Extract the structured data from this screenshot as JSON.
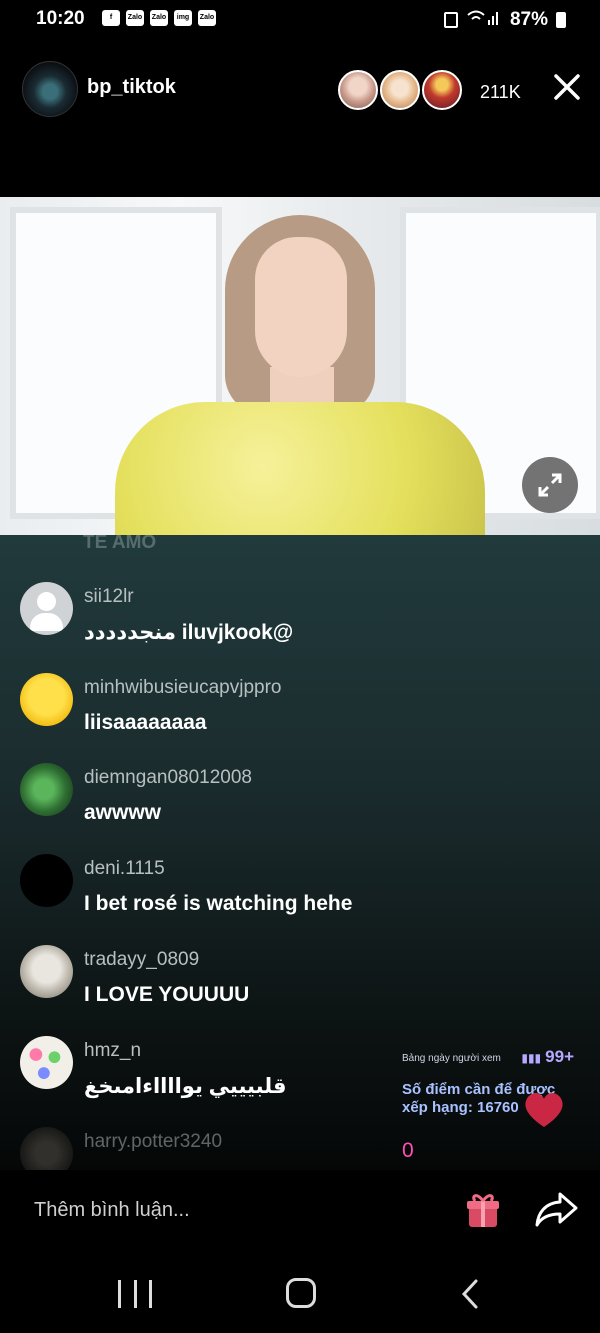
{
  "status_bar": {
    "time": "10:20",
    "app_icons": [
      "f",
      "Zalo",
      "Zalo",
      "img",
      "Zalo"
    ],
    "battery": "87%"
  },
  "header": {
    "host_name": "bp_tiktok",
    "viewer_count": "211K",
    "close_icon": "close-icon"
  },
  "comments": {
    "faded_text": "TE AMO",
    "items": [
      {
        "user": "sii12lr",
        "message": "منجددددد iluvjkook@",
        "avatar": "default-avatar"
      },
      {
        "user": "minhwibusieucapvjppro",
        "message": "liisaaaaaaaa",
        "avatar": "duck-avatar"
      },
      {
        "user": "diemngan08012008",
        "message": "awwww",
        "avatar": "clover-avatar"
      },
      {
        "user": "deni.1115",
        "message": "I bet rosé is watching hehe",
        "avatar": "black-avatar"
      },
      {
        "user": "tradayy_0809",
        "message": "I LOVE YOUUUU",
        "avatar": "anime-avatar"
      },
      {
        "user": "hmz_n",
        "message": "قلبيييي يوااااءامىخغ",
        "avatar": "beads-avatar"
      },
      {
        "user": "harry.potter3240",
        "message": "",
        "avatar": "harry-avatar"
      }
    ]
  },
  "ranking": {
    "title": "Bảng ngày người xem",
    "badge": "99+",
    "message": "Số điểm cần để được xếp hạng: 16760",
    "score": "0"
  },
  "input": {
    "placeholder": "Thêm bình luận..."
  },
  "colors": {
    "accent_pink": "#ff4fb6",
    "rank_blue": "#a9c2ff",
    "background": "#000000"
  }
}
